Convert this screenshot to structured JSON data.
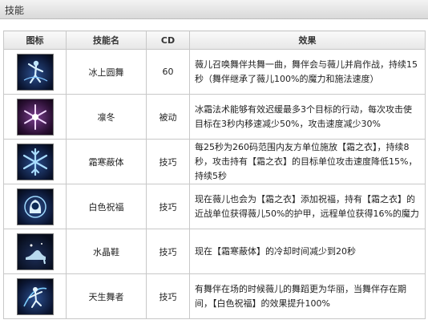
{
  "header": {
    "title": "技能"
  },
  "columns": [
    "图标",
    "技能名",
    "CD",
    "效果"
  ],
  "rows": [
    {
      "icon": "ice-dancer-icon",
      "name": "冰上圆舞",
      "cd": "60",
      "effect": "薇儿召唤舞伴共舞一曲，舞伴会与薇儿并肩作战，持续15秒（舞伴继承了薇儿100%的魔力和施法速度）"
    },
    {
      "icon": "snowflake-purple-icon",
      "name": "凛冬",
      "cd": "被动",
      "effect": "冰霜法术能够有效迟缓最多3个目标的行动，每次攻击使目标在3秒内移速减少50%，攻击速度减少30%"
    },
    {
      "icon": "snowflake-blue-icon",
      "name": "霜寒蔽体",
      "cd": "技巧",
      "effect": "每25秒为260码范围内友方单位施放【霜之衣】，持续8秒，攻击持有【霜之衣】的目标单位攻击速度降低15%，持续5秒"
    },
    {
      "icon": "blessing-girl-icon",
      "name": "白色祝福",
      "cd": "技巧",
      "effect": "现在薇儿也会为【霜之衣】添加祝福，持有【霜之衣】的近战单位获得薇儿50%的护甲，远程单位获得16%的魔力"
    },
    {
      "icon": "crystal-shoe-icon",
      "name": "水晶鞋",
      "cd": "技巧",
      "effect": "现在【霜寒蔽体】的冷却时间减少到20秒"
    },
    {
      "icon": "born-dancer-icon",
      "name": "天生舞者",
      "cd": "技巧",
      "effect": "有舞伴在场的时候薇儿的舞蹈更为华丽，当舞伴存在期间，【白色祝福】的效果提升100%"
    }
  ]
}
